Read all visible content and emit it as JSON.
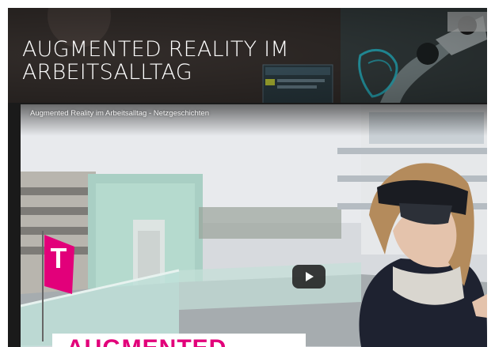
{
  "banner": {
    "title": "AUGMENTED REALITY IM ARBEITSALLTAG"
  },
  "video": {
    "title": "Augmented Reality im Arbeitsalltag - Netzgeschichten",
    "play_icon": "play-icon",
    "overlay_heading": "AUGMENTED",
    "colors": {
      "overlay_heading": "#e2007a",
      "brand_flag": "#e2007a",
      "play_button_bg": "#212121"
    }
  }
}
